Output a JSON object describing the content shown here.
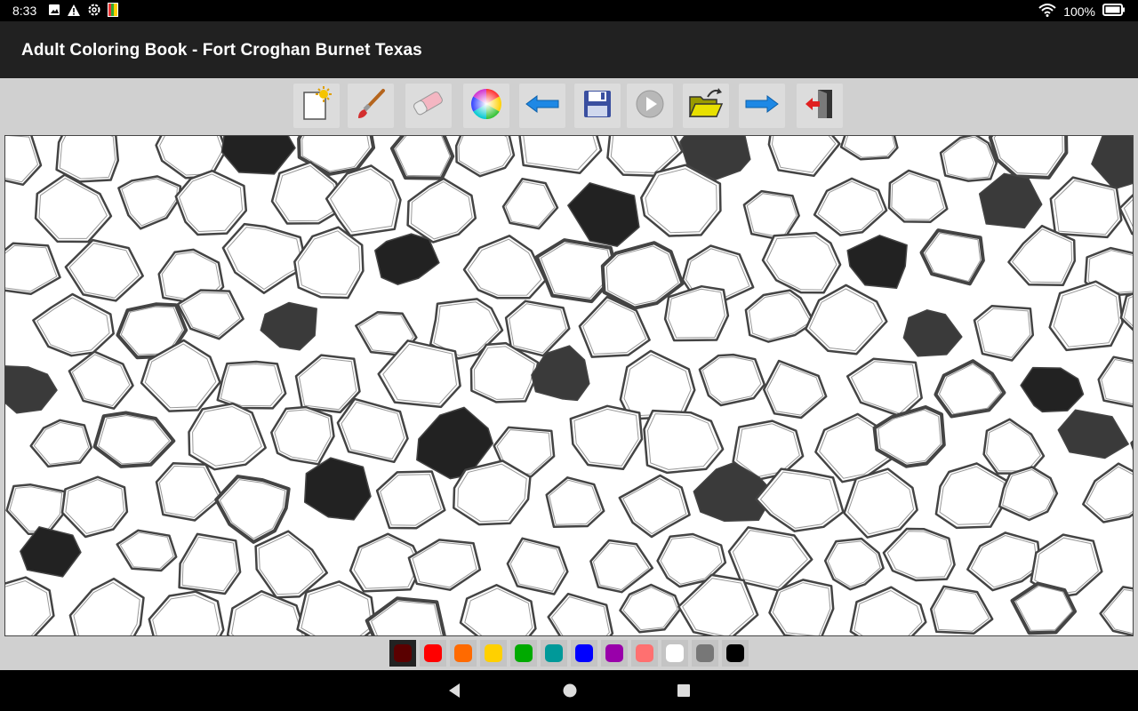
{
  "status": {
    "time": "8:33",
    "battery": "100%",
    "icons": [
      "image-icon",
      "warning-icon",
      "settings-icon",
      "app-icon",
      "wifi-icon",
      "battery-icon"
    ]
  },
  "appbar": {
    "title": "Adult Coloring Book - Fort Croghan Burnet Texas"
  },
  "toolbar": {
    "tools": [
      "new-page-icon",
      "brush-icon",
      "eraser-icon",
      "color-wheel-icon",
      "undo-arrow-icon",
      "save-icon",
      "play-icon",
      "open-folder-icon",
      "redo-arrow-icon",
      "exit-icon"
    ]
  },
  "palette": {
    "colors": [
      "#5a0000",
      "#ff0000",
      "#ff6a00",
      "#ffd000",
      "#00aa00",
      "#009999",
      "#0000ff",
      "#9900aa",
      "#ff7070",
      "#ffffff",
      "#777777",
      "#000000"
    ],
    "selected_index": 0
  },
  "navbar": {
    "icons": [
      "back-icon",
      "home-icon",
      "recents-icon"
    ]
  }
}
